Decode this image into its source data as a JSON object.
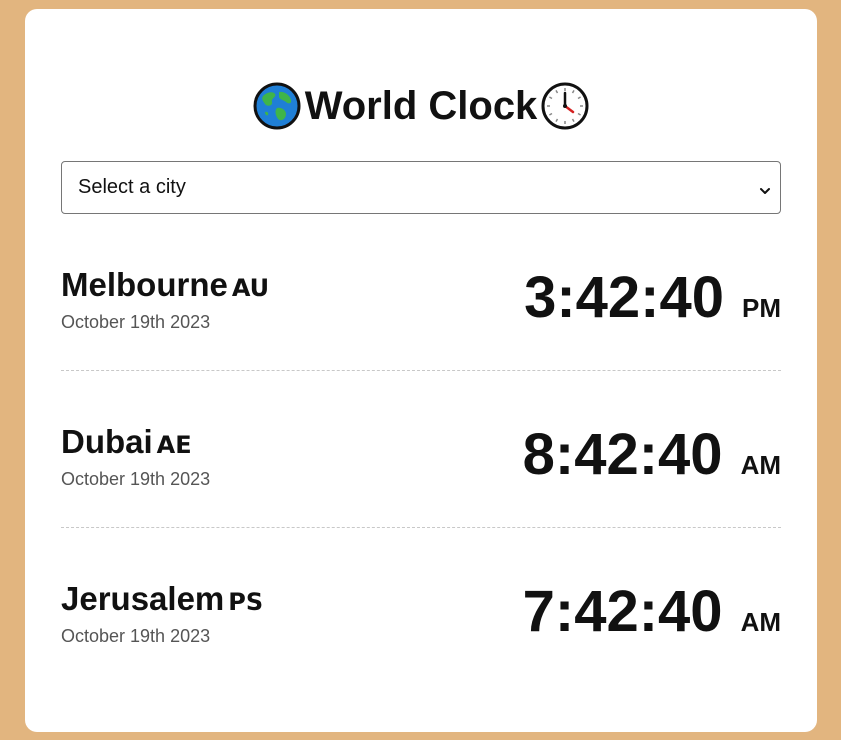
{
  "app": {
    "title": "World Clock",
    "title_icon_left": "globe-icon",
    "title_icon_right": "clock-icon"
  },
  "city_select": {
    "selected_label": "Select a city",
    "icon": "chevron-down-icon"
  },
  "cities": [
    {
      "name": "Melbourne",
      "country": "AU",
      "date": "October 19th 2023",
      "time": "3:42:40",
      "period": "PM"
    },
    {
      "name": "Dubai",
      "country": "AE",
      "date": "October 19th 2023",
      "time": "8:42:40",
      "period": "AM"
    },
    {
      "name": "Jerusalem",
      "country": "PS",
      "date": "October 19th 2023",
      "time": "7:42:40",
      "period": "AM"
    }
  ],
  "colors": {
    "background": "#e2b57f",
    "card": "#ffffff",
    "text": "#111111",
    "muted": "#555555",
    "divider": "#c8c8c8"
  }
}
